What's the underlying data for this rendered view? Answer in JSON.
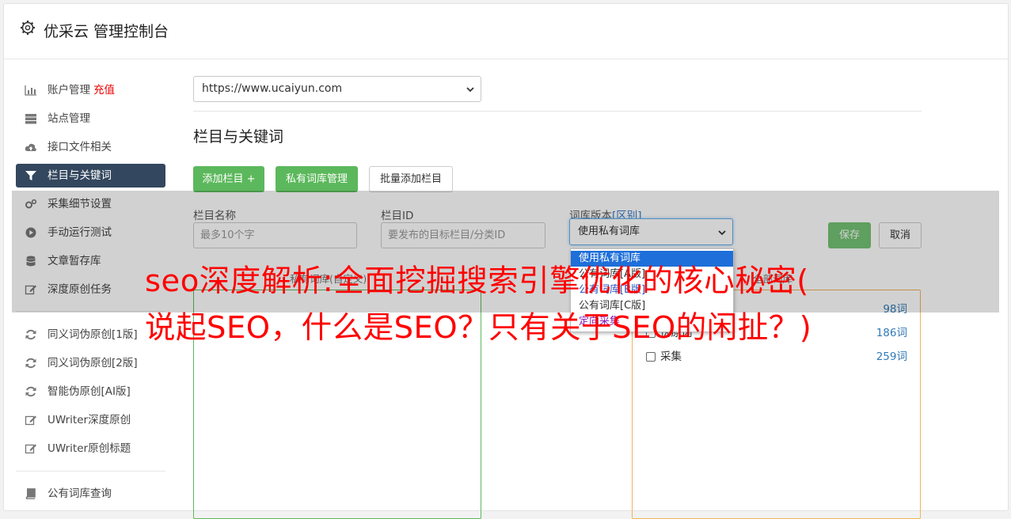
{
  "header": {
    "title": "优采云 管理控制台"
  },
  "sidebar": {
    "items": [
      {
        "label": "账户管理",
        "badge": "充值",
        "icon": "bar-chart-icon"
      },
      {
        "label": "站点管理",
        "icon": "server-icon"
      },
      {
        "label": "接口文件相关",
        "icon": "cloud-upload-icon"
      },
      {
        "label": "栏目与关键词",
        "icon": "filter-icon",
        "active": true
      },
      {
        "label": "采集细节设置",
        "icon": "gears-icon"
      },
      {
        "label": "手动运行测试",
        "icon": "play-circle-icon"
      },
      {
        "label": "文章暂存库",
        "icon": "database-icon"
      },
      {
        "label": "深度原创任务",
        "icon": "edit-icon"
      },
      {
        "label": "同义词伪原创[1版]",
        "icon": "refresh-icon"
      },
      {
        "label": "同义词伪原创[2版]",
        "icon": "refresh-icon"
      },
      {
        "label": "智能伪原创[AI版]",
        "icon": "refresh-icon"
      },
      {
        "label": "UWriter深度原创",
        "icon": "edit-icon"
      },
      {
        "label": "UWriter原创标题",
        "icon": "edit-icon"
      },
      {
        "label": "公有词库查询",
        "icon": "book-icon"
      }
    ]
  },
  "main": {
    "site_select": {
      "value": "https://www.ucaiyun.com"
    },
    "section_title": "栏目与关键词",
    "buttons": {
      "add_column": "添加栏目 +",
      "private_lib": "私有词库管理",
      "batch_add": "批量添加栏目",
      "save": "保存",
      "cancel": "取消"
    },
    "form": {
      "name_label": "栏目名称",
      "name_placeholder": "最多10个字",
      "id_label": "栏目ID",
      "id_placeholder": "要发布的目标栏目/分类ID",
      "version_label": "词库版本",
      "version_label_link": "[区别]",
      "version_value": "使用私有词库"
    },
    "dropdown_options": [
      "使用私有词库",
      "公有词库[A版]",
      "公有词库[B版]",
      "公有词库[C版]",
      "定向采集"
    ],
    "panel_left_title": "私有词库(自定义)",
    "panel_right_title": "全部词库",
    "library_rows": [
      {
        "name": "",
        "count": "98词"
      },
      {
        "name": "伪原创",
        "count": "186词"
      },
      {
        "name": "采集",
        "count": "259词"
      }
    ]
  },
  "overlay": {
    "headline_line1": "seo深度解析:全面挖掘搜索引擎优化的核心秘密(",
    "headline_line2": "说起SEO，什么是SEO？只有关于SEO的闲扯？)"
  },
  "colors": {
    "sidebar_active": "#33475e",
    "green": "#5cb85c",
    "headline": "#ff0000",
    "link": "#337ab7"
  }
}
